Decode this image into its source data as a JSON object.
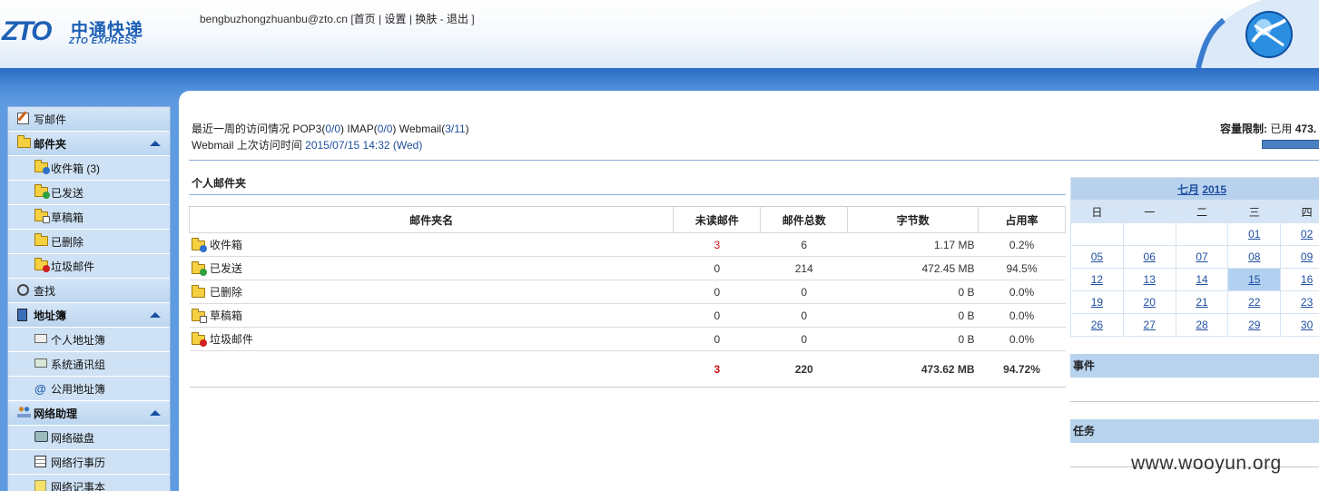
{
  "header": {
    "logo_text": "ZTO",
    "logo_cn": "中通快递",
    "logo_en": "ZTO EXPRESS",
    "email": "bengbuzhongzhuanbu@zto.cn",
    "bracket_open": "[",
    "bracket_close": "]",
    "links": [
      "首页",
      "设置",
      "换肤",
      "退出"
    ],
    "separators": [
      "|",
      "|",
      "-"
    ]
  },
  "sidebar": {
    "items": [
      {
        "label": "写邮件",
        "icon": "compose-icon",
        "level": 1
      },
      {
        "label": "邮件夹",
        "icon": "folders-icon",
        "level": 1,
        "expanded": true
      },
      {
        "label": "收件箱 (3)",
        "icon": "inbox-folder-icon",
        "level": 2
      },
      {
        "label": "已发送",
        "icon": "sent-folder-icon",
        "level": 2
      },
      {
        "label": "草稿箱",
        "icon": "drafts-folder-icon",
        "level": 2
      },
      {
        "label": "已删除",
        "icon": "deleted-folder-icon",
        "level": 2
      },
      {
        "label": "垃圾邮件",
        "icon": "spam-folder-icon",
        "level": 2
      },
      {
        "label": "查找",
        "icon": "search-icon",
        "level": 1
      },
      {
        "label": "地址簿",
        "icon": "addressbook-icon",
        "level": 1,
        "expanded": true
      },
      {
        "label": "个人地址簿",
        "icon": "contact-card-icon",
        "level": 2
      },
      {
        "label": "系统通讯组",
        "icon": "group-card-icon",
        "level": 2
      },
      {
        "label": "公用地址簿",
        "icon": "at-icon",
        "level": 2
      },
      {
        "label": "网络助理",
        "icon": "people-icon",
        "level": 1,
        "expanded": true
      },
      {
        "label": "网络磁盘",
        "icon": "disk-icon",
        "level": 2
      },
      {
        "label": "网络行事历",
        "icon": "calendar-icon",
        "level": 2
      },
      {
        "label": "网络记事本",
        "icon": "notepad-icon",
        "level": 2
      }
    ]
  },
  "visit": {
    "line1_prefix": "最近一周的访问情况 POP3(",
    "pop3": "0/0",
    "imap_prefix": ") IMAP(",
    "imap": "0/0",
    "webmail_prefix": ") Webmail(",
    "webmail": "3/11",
    "line1_suffix": ")",
    "line2_prefix": "Webmail 上次访问时间 ",
    "last_time": "2015/07/15 14:32 (Wed)"
  },
  "quota": {
    "label": "容量限制",
    "colon": ":",
    "used_label": "已用",
    "used_value": "473.",
    "used_fraction": 0.9472
  },
  "personal_folders": {
    "title": "个人邮件夹",
    "columns": [
      "邮件夹名",
      "未读邮件",
      "邮件总数",
      "字节数",
      "占用率"
    ],
    "rows": [
      {
        "name": "收件箱",
        "unread": "3",
        "total": "6",
        "bytes": "1.17 MB",
        "ratio": "0.2%"
      },
      {
        "name": "已发送",
        "unread": "0",
        "total": "214",
        "bytes": "472.45 MB",
        "ratio": "94.5%"
      },
      {
        "name": "已删除",
        "unread": "0",
        "total": "0",
        "bytes": "0 B",
        "ratio": "0.0%"
      },
      {
        "name": "草稿箱",
        "unread": "0",
        "total": "0",
        "bytes": "0 B",
        "ratio": "0.0%"
      },
      {
        "name": "垃圾邮件",
        "unread": "0",
        "total": "0",
        "bytes": "0 B",
        "ratio": "0.0%"
      }
    ],
    "totals": {
      "unread": "3",
      "total": "220",
      "bytes": "473.62 MB",
      "ratio": "94.72%"
    }
  },
  "calendar": {
    "month": "七月",
    "year": "2015",
    "weekdays": [
      "日",
      "一",
      "二",
      "三",
      "四"
    ],
    "weeks": [
      [
        "",
        "",
        "",
        "01",
        "02"
      ],
      [
        "05",
        "06",
        "07",
        "08",
        "09"
      ],
      [
        "12",
        "13",
        "14",
        "15",
        "16"
      ],
      [
        "19",
        "20",
        "21",
        "22",
        "23"
      ],
      [
        "26",
        "27",
        "28",
        "29",
        "30"
      ]
    ],
    "today": "15"
  },
  "events": {
    "title": "事件"
  },
  "tasks": {
    "title": "任务"
  },
  "watermark": "www.wooyun.org",
  "colors": {
    "brand_blue": "#1d5fb5",
    "band_blue": "#2a6cc4",
    "unread_red": "#d01010",
    "sidebar_bg": "#b7d3ee"
  }
}
